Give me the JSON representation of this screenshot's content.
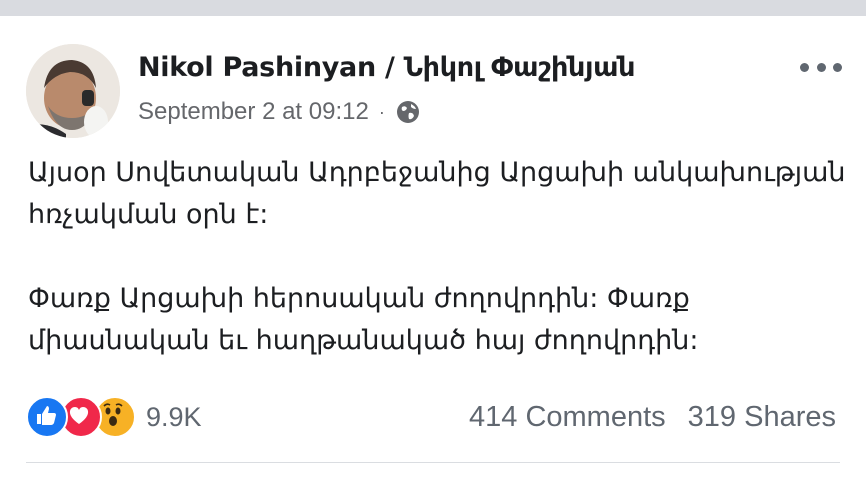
{
  "post": {
    "author": "Nikol Pashinyan / Նիկոլ Փաշինյան",
    "timestamp": "September 2 at 09:12",
    "separator": "·",
    "privacy_icon": "globe-icon",
    "paragraphs": [
      "Այսօր Սովետական Ադրբեջանից Արցախի անկախության հռչակման օրն է:",
      "Փառք Արցախի հերոսական ժողովրդին: Փառք միասնական եւ հաղթանակած հայ ժողովրդին:"
    ],
    "reactions": {
      "icons": [
        "like-icon",
        "love-icon",
        "wow-icon"
      ],
      "count": "9.9K"
    },
    "comments": "414 Comments",
    "shares": "319 Shares"
  },
  "colors": {
    "like": "#1877f2",
    "love": "#f0284a",
    "wow": "#f7b125",
    "secondary_text": "#606770"
  }
}
